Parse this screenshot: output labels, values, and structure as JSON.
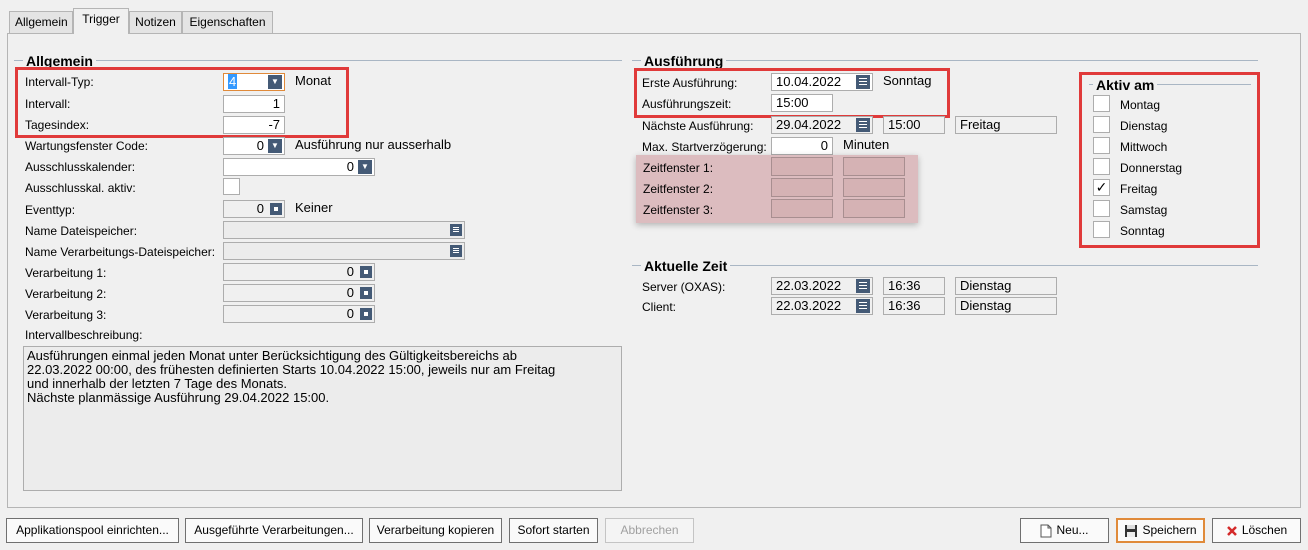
{
  "tabs": [
    "Allgemein",
    "Trigger",
    "Notizen",
    "Eigenschaften"
  ],
  "allgemein": {
    "title": "Allgemein",
    "intervall_typ": {
      "label": "Intervall-Typ:",
      "value": "4",
      "suffix": "Monat"
    },
    "intervall": {
      "label": "Intervall:",
      "value": "1"
    },
    "tagesindex": {
      "label": "Tagesindex:",
      "value": "-7"
    },
    "wartungsfenster": {
      "label": "Wartungsfenster Code:",
      "value": "0",
      "suffix": "Ausführung nur ausserhalb"
    },
    "ausschlusskalender": {
      "label": "Ausschlusskalender:",
      "value": "0"
    },
    "ausschlusskal_aktiv": {
      "label": "Ausschlusskal. aktiv:"
    },
    "eventtyp": {
      "label": "Eventtyp:",
      "value": "0",
      "suffix": "Keiner"
    },
    "name_dateispeicher": {
      "label": "Name Dateispeicher:",
      "value": ""
    },
    "name_verarbeitungs_dateispeicher": {
      "label": "Name Verarbeitungs-Dateispeicher:",
      "value": ""
    },
    "verarbeitung_1": {
      "label": "Verarbeitung 1:",
      "value": "0"
    },
    "verarbeitung_2": {
      "label": "Verarbeitung 2:",
      "value": "0"
    },
    "verarbeitung_3": {
      "label": "Verarbeitung 3:",
      "value": "0"
    },
    "intervallbeschreibung": {
      "label": "Intervallbeschreibung:",
      "lines": [
        "Ausführungen einmal jeden Monat unter Berücksichtigung des Gültigkeitsbereichs ab",
        "22.03.2022 00:00, des frühesten definierten Starts 10.04.2022 15:00, jeweils nur am Freitag",
        "und innerhalb der letzten 7 Tage des Monats.",
        "Nächste planmässige Ausführung 29.04.2022 15:00."
      ]
    }
  },
  "ausfuehrung": {
    "title": "Ausführung",
    "erste": {
      "label": "Erste Ausführung:",
      "date": "10.04.2022",
      "day": "Sonntag"
    },
    "zeit": {
      "label": "Ausführungszeit:",
      "value": "15:00"
    },
    "naechste": {
      "label": "Nächste Ausführung:",
      "date": "29.04.2022",
      "time": "15:00",
      "day": "Freitag"
    },
    "startverzoegerung": {
      "label": "Max. Startverzögerung:",
      "value": "0",
      "unit": "Minuten"
    },
    "zeitfenster_1": {
      "label": "Zeitfenster 1:"
    },
    "zeitfenster_2": {
      "label": "Zeitfenster 2:"
    },
    "zeitfenster_3": {
      "label": "Zeitfenster 3:"
    }
  },
  "aktuelle_zeit": {
    "title": "Aktuelle Zeit",
    "server": {
      "label": "Server (OXAS):",
      "date": "22.03.2022",
      "time": "16:36",
      "day": "Dienstag"
    },
    "client": {
      "label": "Client:",
      "date": "22.03.2022",
      "time": "16:36",
      "day": "Dienstag"
    }
  },
  "aktiv_am": {
    "title": "Aktiv am",
    "days": [
      {
        "label": "Montag",
        "checked": false
      },
      {
        "label": "Dienstag",
        "checked": false
      },
      {
        "label": "Mittwoch",
        "checked": false
      },
      {
        "label": "Donnerstag",
        "checked": false
      },
      {
        "label": "Freitag",
        "checked": true
      },
      {
        "label": "Samstag",
        "checked": false
      },
      {
        "label": "Sonntag",
        "checked": false
      }
    ],
    "check_glyph": "✓"
  },
  "buttons": {
    "applikationspool": "Applikationspool einrichten...",
    "ausgefuehrte": "Ausgeführte Verarbeitungen...",
    "kopieren": "Verarbeitung kopieren",
    "sofort": "Sofort starten",
    "abbrechen": "Abbrechen",
    "neu": "Neu...",
    "speichern": "Speichern",
    "loeschen": "Löschen"
  },
  "colors": {
    "highlight_border": "#e03a3a",
    "zeitfenster_bg": "#dcbcbf",
    "field_button": "#445a76"
  },
  "icons": {
    "dropdown": "chevron-down-icon",
    "calendar": "calendar-icon",
    "new": "new-document-icon",
    "save": "floppy-disk-icon",
    "delete": "red-x-icon"
  }
}
